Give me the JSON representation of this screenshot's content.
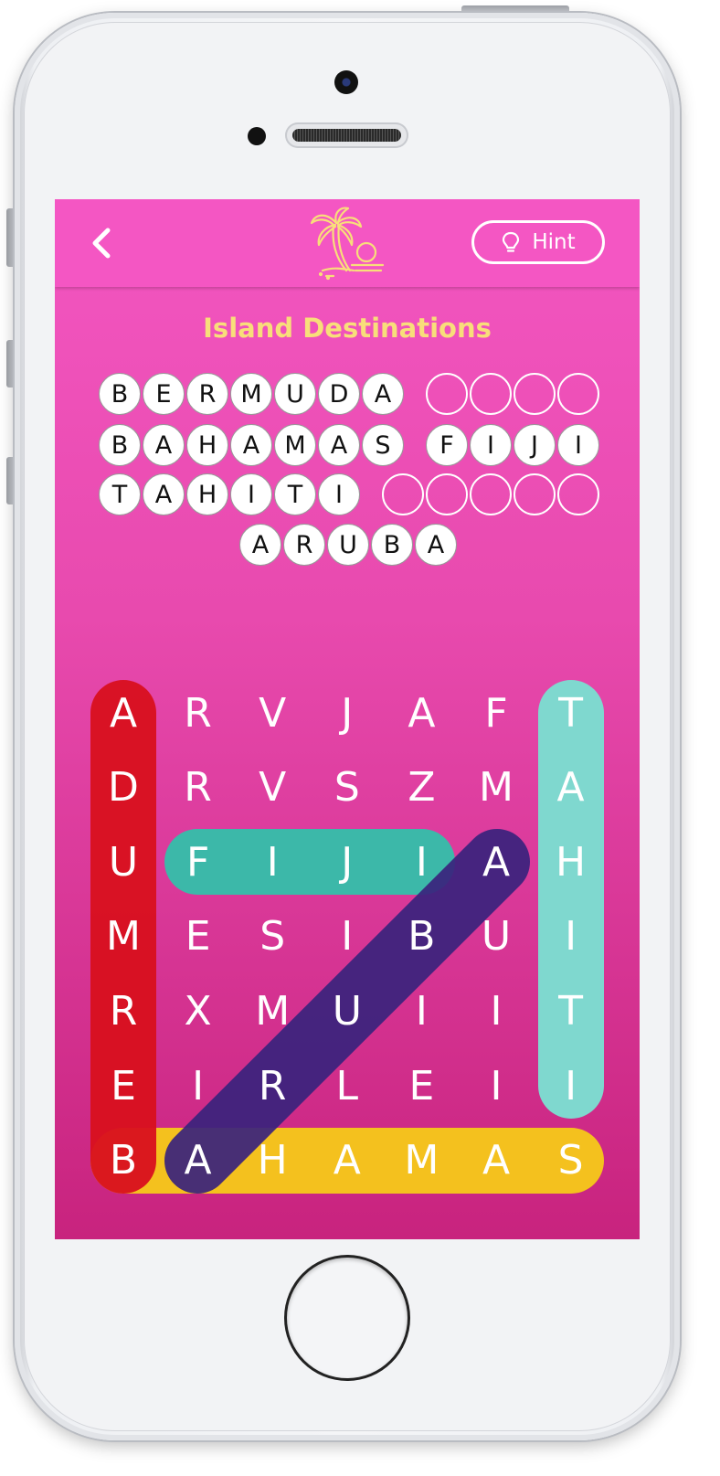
{
  "game": {
    "title": "Island Destinations",
    "hint_label": "Hint",
    "words": [
      {
        "text": "BERMUDA",
        "found": true
      },
      {
        "text": "",
        "found": false,
        "length": 4
      },
      {
        "text": "BAHAMAS",
        "found": true
      },
      {
        "text": "FIJI",
        "found": true
      },
      {
        "text": "TAHITI",
        "found": true
      },
      {
        "text": "",
        "found": false,
        "length": 5
      },
      {
        "text": "ARUBA",
        "found": true
      }
    ],
    "grid": [
      [
        "A",
        "R",
        "V",
        "J",
        "A",
        "F",
        "T"
      ],
      [
        "D",
        "R",
        "V",
        "S",
        "Z",
        "M",
        "A"
      ],
      [
        "U",
        "F",
        "I",
        "J",
        "I",
        "A",
        "H"
      ],
      [
        "M",
        "E",
        "S",
        "I",
        "B",
        "U",
        "I"
      ],
      [
        "R",
        "X",
        "M",
        "U",
        "I",
        "I",
        "T"
      ],
      [
        "E",
        "I",
        "R",
        "L",
        "E",
        "I",
        "I"
      ],
      [
        "B",
        "A",
        "H",
        "A",
        "M",
        "A",
        "S"
      ]
    ],
    "highlights": [
      {
        "word": "BERMUDA",
        "color": "#d9101e"
      },
      {
        "word": "BAHAMAS",
        "color": "#f4c11e"
      },
      {
        "word": "TAHITI",
        "color": "#7fd8cf"
      },
      {
        "word": "FIJI",
        "color": "#2fc3ab"
      },
      {
        "word": "ARUBA",
        "color": "#3a237d"
      }
    ]
  },
  "colors": {
    "screen_top": "#f356c1",
    "screen_bottom": "#c8237e",
    "title": "#f8de7a"
  }
}
